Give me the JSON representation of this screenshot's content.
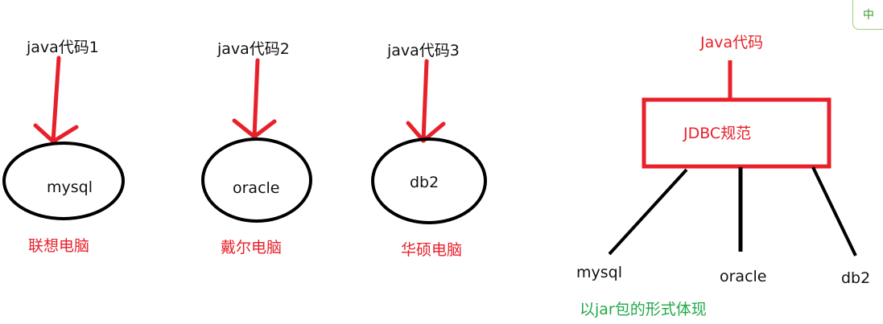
{
  "left_diagram": {
    "items": [
      {
        "code_label": "java代码1",
        "db_label": "mysql",
        "computer_label": "联想电脑"
      },
      {
        "code_label": "java代码2",
        "db_label": "oracle",
        "computer_label": "戴尔电脑"
      },
      {
        "code_label": "java代码3",
        "db_label": "db2",
        "computer_label": "华硕电脑"
      }
    ]
  },
  "right_diagram": {
    "top_label": "Java代码",
    "box_label": "JDBC规范",
    "drivers": [
      "mysql",
      "oracle",
      "db2"
    ],
    "note": "以jar包的形式体现"
  },
  "ime_indicator": "中",
  "colors": {
    "arrow": "#e8202a",
    "ellipse": "#000000",
    "text_red": "#e8202a",
    "note_green": "#22a84a"
  }
}
